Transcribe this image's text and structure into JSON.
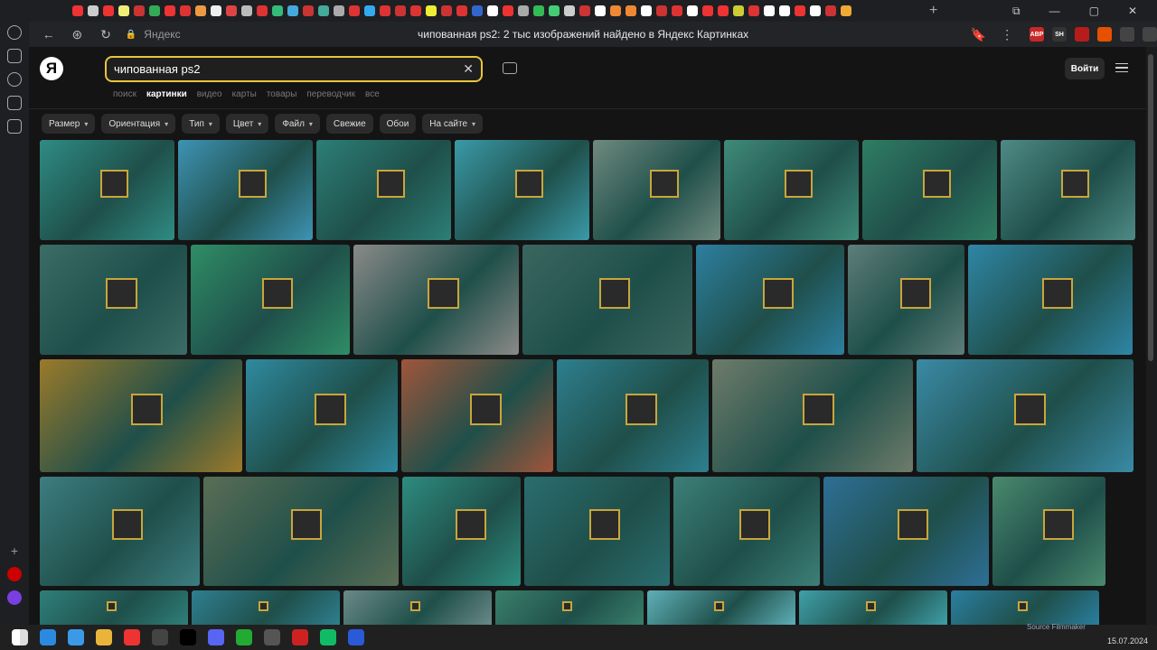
{
  "browser": {
    "site_label": "Яндекс",
    "page_title": "чипованная ps2: 2 тыс изображений найдено в Яндекс Картинках",
    "extensions": [
      "ABP",
      "SH",
      "",
      "",
      "",
      ""
    ],
    "tab_colors": [
      "#e33",
      "#ccc",
      "#e33",
      "#ee7",
      "#c33",
      "#3a5",
      "#e33",
      "#d33",
      "#e94",
      "#eee",
      "#d44",
      "#bbb",
      "#d33",
      "#3b7",
      "#4ad",
      "#c33",
      "#4a9",
      "#aaa",
      "#d33",
      "#3ae",
      "#d33",
      "#c33",
      "#d33",
      "#ee3",
      "#c33",
      "#d33",
      "#36c",
      "#fff",
      "#e33",
      "#aaa",
      "#3b5",
      "#4c7",
      "#ccc",
      "#c33",
      "#fff",
      "#e83",
      "#e83",
      "#fff",
      "#c33",
      "#d33",
      "#fff",
      "#e33",
      "#e33",
      "#cc3",
      "#d33",
      "#fff",
      "#fff",
      "#e33",
      "#fff",
      "#c33",
      "#ea3"
    ]
  },
  "yandex": {
    "logo": "Я",
    "query": "чипованная ps2",
    "login_label": "Войти",
    "services": [
      {
        "label": "поиск",
        "active": false
      },
      {
        "label": "картинки",
        "active": true
      },
      {
        "label": "видео",
        "active": false
      },
      {
        "label": "карты",
        "active": false
      },
      {
        "label": "товары",
        "active": false
      },
      {
        "label": "переводчик",
        "active": false
      },
      {
        "label": "все",
        "active": false
      }
    ],
    "filters": [
      {
        "label": "Размер",
        "dropdown": true
      },
      {
        "label": "Ориентация",
        "dropdown": true
      },
      {
        "label": "Тип",
        "dropdown": true
      },
      {
        "label": "Цвет",
        "dropdown": true
      },
      {
        "label": "Файл",
        "dropdown": true
      },
      {
        "label": "Свежие",
        "dropdown": false
      },
      {
        "label": "Обои",
        "dropdown": false
      },
      {
        "label": "На сайте",
        "dropdown": true
      }
    ]
  },
  "results": {
    "rows": [
      {
        "colors": [
          "#2f8c84",
          "#3e93b4",
          "#2c7f77",
          "#3a9aa8",
          "#6f8a7e",
          "#3f8b7a",
          "#2f7d63",
          "#4f8a86"
        ]
      },
      {
        "colors": [
          "#3b6c66",
          "#2f8d66",
          "#8a8a88",
          "#3b6660",
          "#2d7fa0",
          "#5e7e7a",
          "#2f86a6"
        ]
      },
      {
        "colors": [
          "#9b7a2a",
          "#2f8aa0",
          "#a0553a",
          "#2e7f8f",
          "#6e7c6a",
          "#3a8aa6"
        ]
      },
      {
        "colors": [
          "#3d7d80",
          "#5a6e55",
          "#2e8c7f",
          "#2a6d6f",
          "#3d7f78",
          "#2e6f96",
          "#4a8a6e"
        ]
      },
      {
        "colors": [
          "#2f7f7a",
          "#2f7f90",
          "#6a8a88",
          "#3a7f6a",
          "#5fb0b8",
          "#3fa0a8",
          "#2a7fa0"
        ]
      }
    ]
  },
  "taskbar": {
    "clock": "15.07.2024",
    "icons": [
      "#fff",
      "#2b8ae0",
      "#3a9ae8",
      "#e8b43a",
      "#e33",
      "#444",
      "#000",
      "#5865f2",
      "#2a3",
      "#555",
      "#c22",
      "#1b6",
      "#2a5ad8"
    ]
  },
  "overlay": {
    "watermark": "Source Filmmaker"
  }
}
